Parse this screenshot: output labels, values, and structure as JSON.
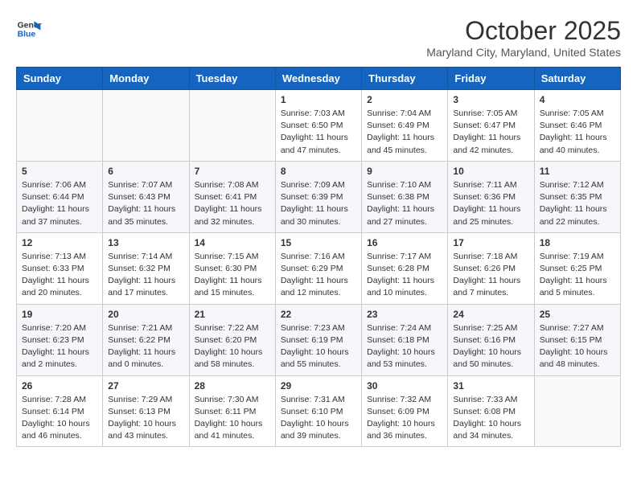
{
  "logo": {
    "line1": "General",
    "line2": "Blue"
  },
  "title": "October 2025",
  "subtitle": "Maryland City, Maryland, United States",
  "days_of_week": [
    "Sunday",
    "Monday",
    "Tuesday",
    "Wednesday",
    "Thursday",
    "Friday",
    "Saturday"
  ],
  "weeks": [
    [
      {
        "num": "",
        "info": ""
      },
      {
        "num": "",
        "info": ""
      },
      {
        "num": "",
        "info": ""
      },
      {
        "num": "1",
        "info": "Sunrise: 7:03 AM\nSunset: 6:50 PM\nDaylight: 11 hours and 47 minutes."
      },
      {
        "num": "2",
        "info": "Sunrise: 7:04 AM\nSunset: 6:49 PM\nDaylight: 11 hours and 45 minutes."
      },
      {
        "num": "3",
        "info": "Sunrise: 7:05 AM\nSunset: 6:47 PM\nDaylight: 11 hours and 42 minutes."
      },
      {
        "num": "4",
        "info": "Sunrise: 7:05 AM\nSunset: 6:46 PM\nDaylight: 11 hours and 40 minutes."
      }
    ],
    [
      {
        "num": "5",
        "info": "Sunrise: 7:06 AM\nSunset: 6:44 PM\nDaylight: 11 hours and 37 minutes."
      },
      {
        "num": "6",
        "info": "Sunrise: 7:07 AM\nSunset: 6:43 PM\nDaylight: 11 hours and 35 minutes."
      },
      {
        "num": "7",
        "info": "Sunrise: 7:08 AM\nSunset: 6:41 PM\nDaylight: 11 hours and 32 minutes."
      },
      {
        "num": "8",
        "info": "Sunrise: 7:09 AM\nSunset: 6:39 PM\nDaylight: 11 hours and 30 minutes."
      },
      {
        "num": "9",
        "info": "Sunrise: 7:10 AM\nSunset: 6:38 PM\nDaylight: 11 hours and 27 minutes."
      },
      {
        "num": "10",
        "info": "Sunrise: 7:11 AM\nSunset: 6:36 PM\nDaylight: 11 hours and 25 minutes."
      },
      {
        "num": "11",
        "info": "Sunrise: 7:12 AM\nSunset: 6:35 PM\nDaylight: 11 hours and 22 minutes."
      }
    ],
    [
      {
        "num": "12",
        "info": "Sunrise: 7:13 AM\nSunset: 6:33 PM\nDaylight: 11 hours and 20 minutes."
      },
      {
        "num": "13",
        "info": "Sunrise: 7:14 AM\nSunset: 6:32 PM\nDaylight: 11 hours and 17 minutes."
      },
      {
        "num": "14",
        "info": "Sunrise: 7:15 AM\nSunset: 6:30 PM\nDaylight: 11 hours and 15 minutes."
      },
      {
        "num": "15",
        "info": "Sunrise: 7:16 AM\nSunset: 6:29 PM\nDaylight: 11 hours and 12 minutes."
      },
      {
        "num": "16",
        "info": "Sunrise: 7:17 AM\nSunset: 6:28 PM\nDaylight: 11 hours and 10 minutes."
      },
      {
        "num": "17",
        "info": "Sunrise: 7:18 AM\nSunset: 6:26 PM\nDaylight: 11 hours and 7 minutes."
      },
      {
        "num": "18",
        "info": "Sunrise: 7:19 AM\nSunset: 6:25 PM\nDaylight: 11 hours and 5 minutes."
      }
    ],
    [
      {
        "num": "19",
        "info": "Sunrise: 7:20 AM\nSunset: 6:23 PM\nDaylight: 11 hours and 2 minutes."
      },
      {
        "num": "20",
        "info": "Sunrise: 7:21 AM\nSunset: 6:22 PM\nDaylight: 11 hours and 0 minutes."
      },
      {
        "num": "21",
        "info": "Sunrise: 7:22 AM\nSunset: 6:20 PM\nDaylight: 10 hours and 58 minutes."
      },
      {
        "num": "22",
        "info": "Sunrise: 7:23 AM\nSunset: 6:19 PM\nDaylight: 10 hours and 55 minutes."
      },
      {
        "num": "23",
        "info": "Sunrise: 7:24 AM\nSunset: 6:18 PM\nDaylight: 10 hours and 53 minutes."
      },
      {
        "num": "24",
        "info": "Sunrise: 7:25 AM\nSunset: 6:16 PM\nDaylight: 10 hours and 50 minutes."
      },
      {
        "num": "25",
        "info": "Sunrise: 7:27 AM\nSunset: 6:15 PM\nDaylight: 10 hours and 48 minutes."
      }
    ],
    [
      {
        "num": "26",
        "info": "Sunrise: 7:28 AM\nSunset: 6:14 PM\nDaylight: 10 hours and 46 minutes."
      },
      {
        "num": "27",
        "info": "Sunrise: 7:29 AM\nSunset: 6:13 PM\nDaylight: 10 hours and 43 minutes."
      },
      {
        "num": "28",
        "info": "Sunrise: 7:30 AM\nSunset: 6:11 PM\nDaylight: 10 hours and 41 minutes."
      },
      {
        "num": "29",
        "info": "Sunrise: 7:31 AM\nSunset: 6:10 PM\nDaylight: 10 hours and 39 minutes."
      },
      {
        "num": "30",
        "info": "Sunrise: 7:32 AM\nSunset: 6:09 PM\nDaylight: 10 hours and 36 minutes."
      },
      {
        "num": "31",
        "info": "Sunrise: 7:33 AM\nSunset: 6:08 PM\nDaylight: 10 hours and 34 minutes."
      },
      {
        "num": "",
        "info": ""
      }
    ]
  ]
}
